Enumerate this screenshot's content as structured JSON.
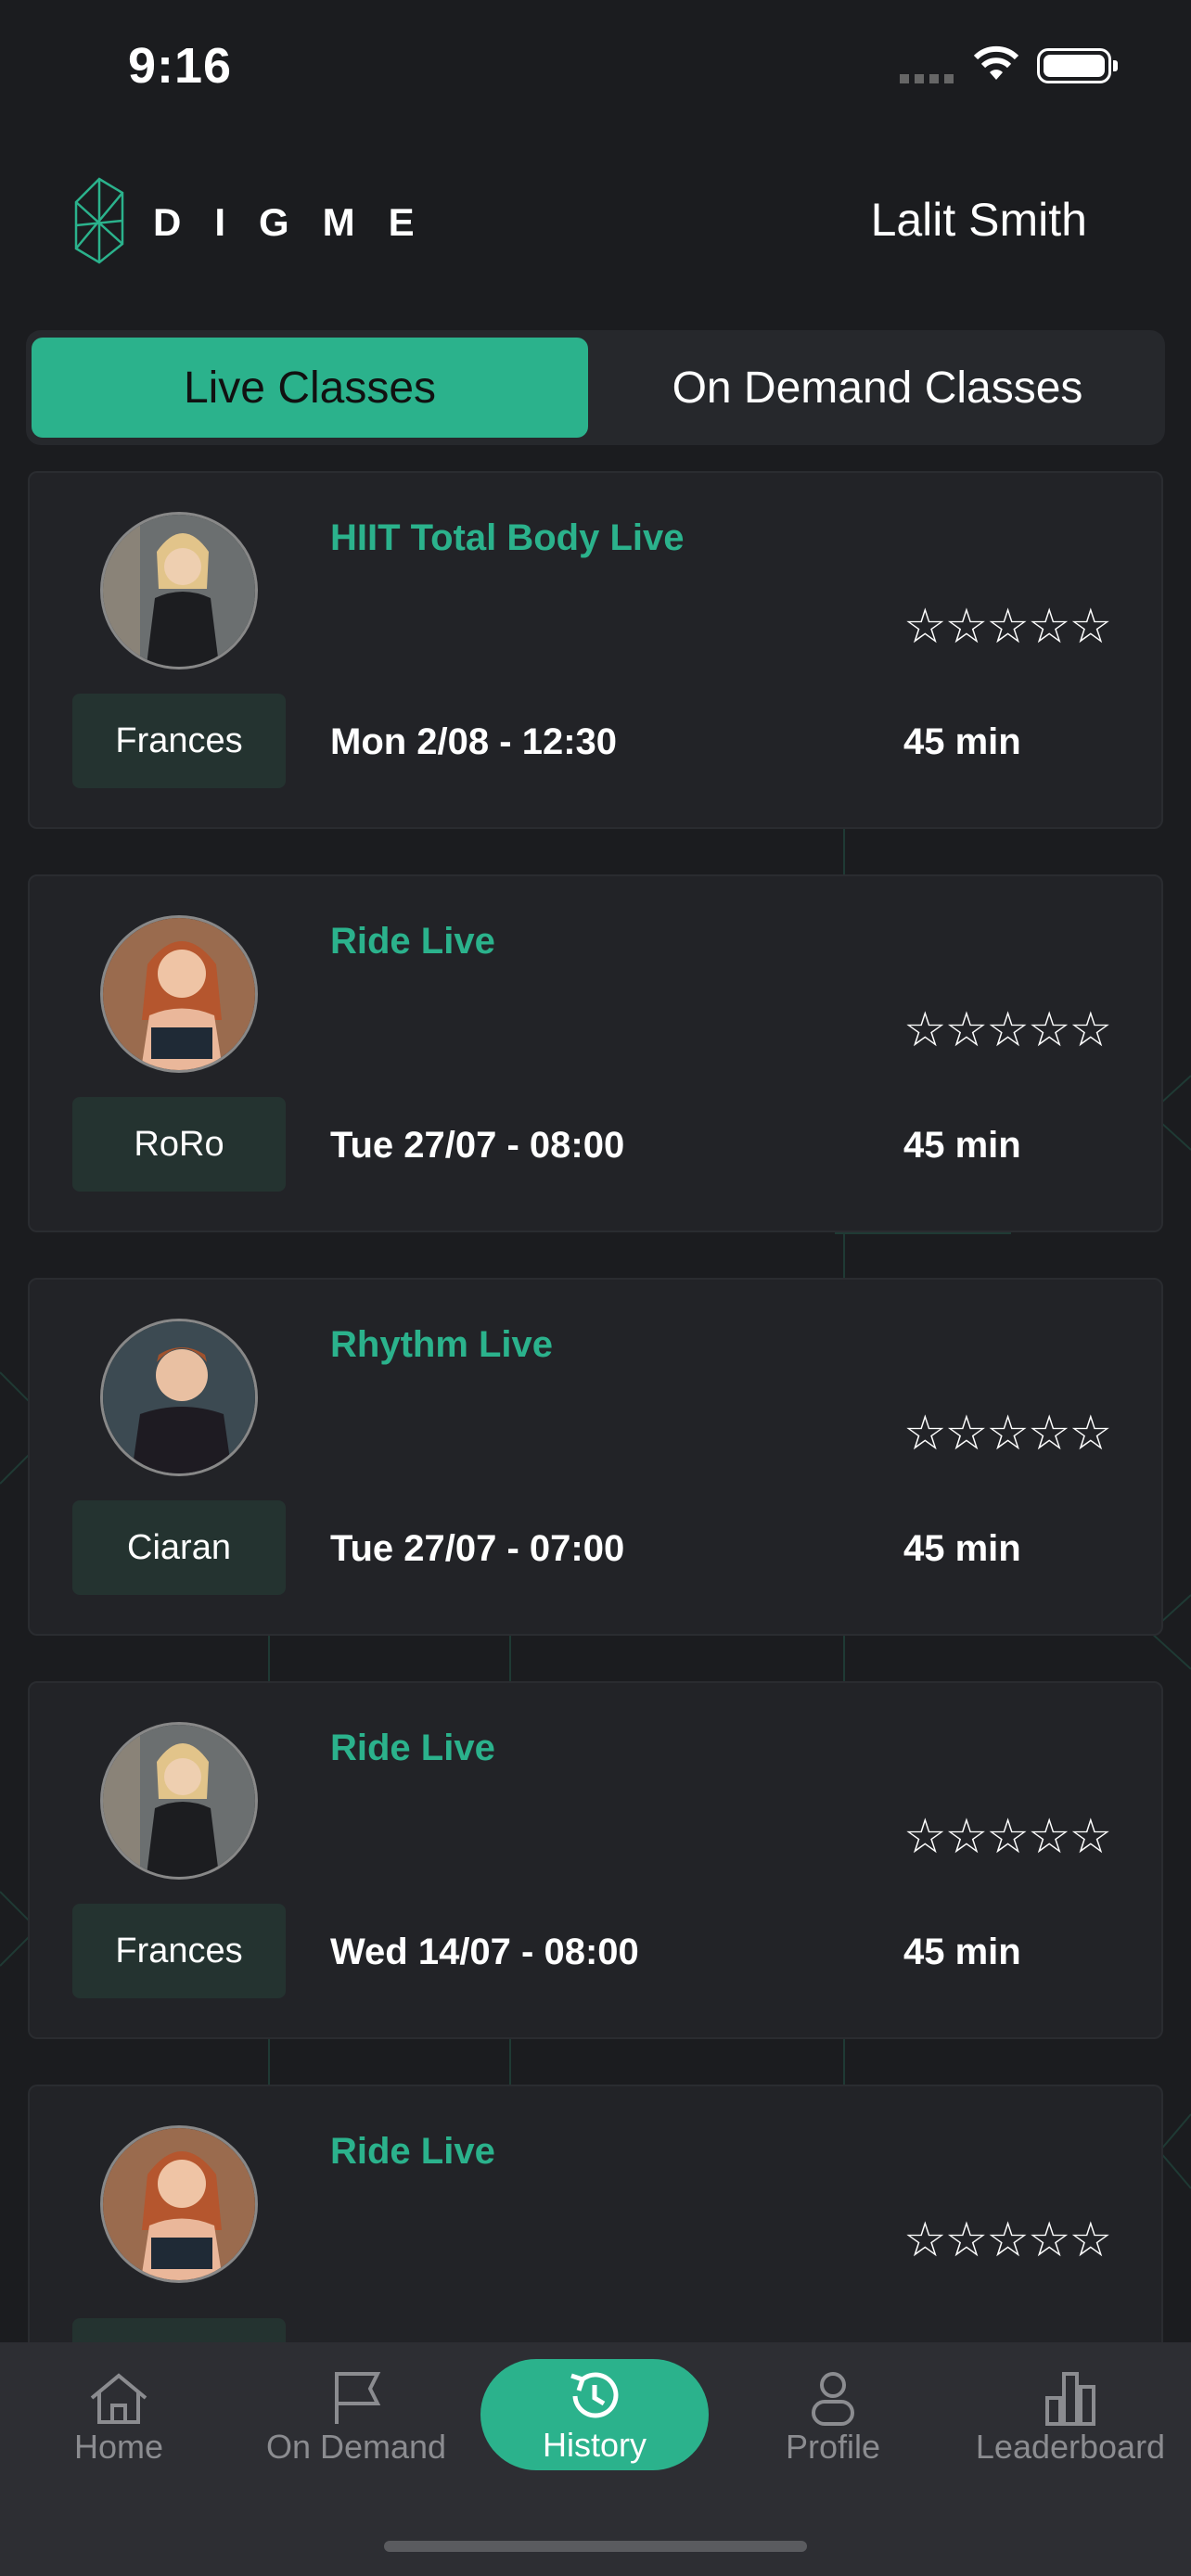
{
  "status_bar": {
    "time": "9:16"
  },
  "header": {
    "logo_text": "DIGME",
    "user_name": "Lalit Smith"
  },
  "segment": {
    "live_label": "Live Classes",
    "on_demand_label": "On Demand Classes"
  },
  "classes": [
    {
      "title": "HIIT Total Body Live",
      "instructor": "Frances",
      "datetime": "Mon 2/08 - 12:30",
      "duration": "45 min",
      "stars": "☆☆☆☆☆",
      "rating": 0
    },
    {
      "title": "Ride Live",
      "instructor": "RoRo",
      "datetime": "Tue 27/07 - 08:00",
      "duration": "45 min",
      "stars": "☆☆☆☆☆",
      "rating": 0
    },
    {
      "title": "Rhythm Live",
      "instructor": "Ciaran",
      "datetime": "Tue 27/07 - 07:00",
      "duration": "45 min",
      "stars": "☆☆☆☆☆",
      "rating": 0
    },
    {
      "title": "Ride Live",
      "instructor": "Frances",
      "datetime": "Wed 14/07 - 08:00",
      "duration": "45 min",
      "stars": "☆☆☆☆☆",
      "rating": 0
    },
    {
      "title": "Ride Live",
      "instructor": "",
      "datetime": "",
      "duration": "",
      "stars": "☆☆☆☆☆",
      "rating": 0
    }
  ],
  "tab_bar": {
    "items": [
      {
        "label": "Home",
        "icon": "home-icon"
      },
      {
        "label": "On Demand",
        "icon": "flag-icon"
      },
      {
        "label": "History",
        "icon": "history-icon"
      },
      {
        "label": "Profile",
        "icon": "profile-icon"
      },
      {
        "label": "Leaderboard",
        "icon": "leaderboard-icon"
      }
    ],
    "active": "History"
  },
  "colors": {
    "accent": "#2bb28c",
    "background": "#1b1c1f",
    "card": "#222327",
    "tab_bar": "#2d2e33"
  }
}
